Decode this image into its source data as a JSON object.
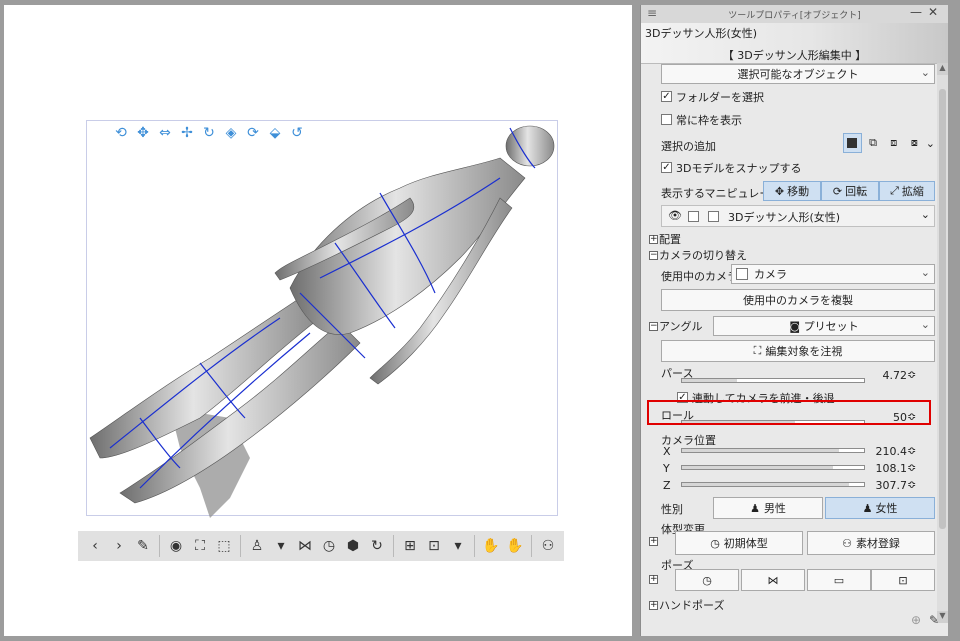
{
  "panel": {
    "title": "ツールプロパティ[オブジェクト]",
    "header_label": "3Dデッサン人形(女性)",
    "header_state": "【 3Dデッサン人形編集中 】",
    "selectable_object": "選択可能なオブジェクト",
    "select_folder": "フォルダーを選択",
    "always_frame": "常に枠を表示",
    "add_selection": "選択の追加",
    "snap_model": "3Dモデルをスナップする",
    "manipulator_label": "表示するマニピュレータ",
    "manip_move": "移動",
    "manip_rotate": "回転",
    "manip_scale": "拡縮",
    "layer_name": "3Dデッサン人形(女性)",
    "placement": "配置",
    "camera_switch": "カメラの切り替え",
    "active_camera": "使用中のカメラ",
    "camera": "カメラ",
    "duplicate_camera": "使用中のカメラを複製",
    "angle": "アングル",
    "preset": "プリセット",
    "focus_target": "編集対象を注視",
    "perspective": "パース",
    "perspective_value": "4.72",
    "perspective_level": 0.3,
    "link_camera": "連動してカメラを前進・後退",
    "roll": "ロール",
    "roll_value": "50",
    "roll_level": 0.62,
    "camera_position": "カメラ位置",
    "x_label": "X",
    "x_value": "210.4",
    "x_level": 0.86,
    "y_label": "Y",
    "y_value": "108.1",
    "y_level": 0.83,
    "z_label": "Z",
    "z_value": "307.7",
    "z_level": 0.92,
    "gender": "性別",
    "male": "男性",
    "female": "女性",
    "body_change": "体型変更",
    "initial_body": "初期体型",
    "register_material": "素材登録",
    "pose": "ポーズ",
    "hand_pose": "ハンドポーズ"
  },
  "colors": {
    "accent": "#3e8fd8",
    "highlight_box": "#e00000",
    "segment_active": "#cfe0f2"
  }
}
